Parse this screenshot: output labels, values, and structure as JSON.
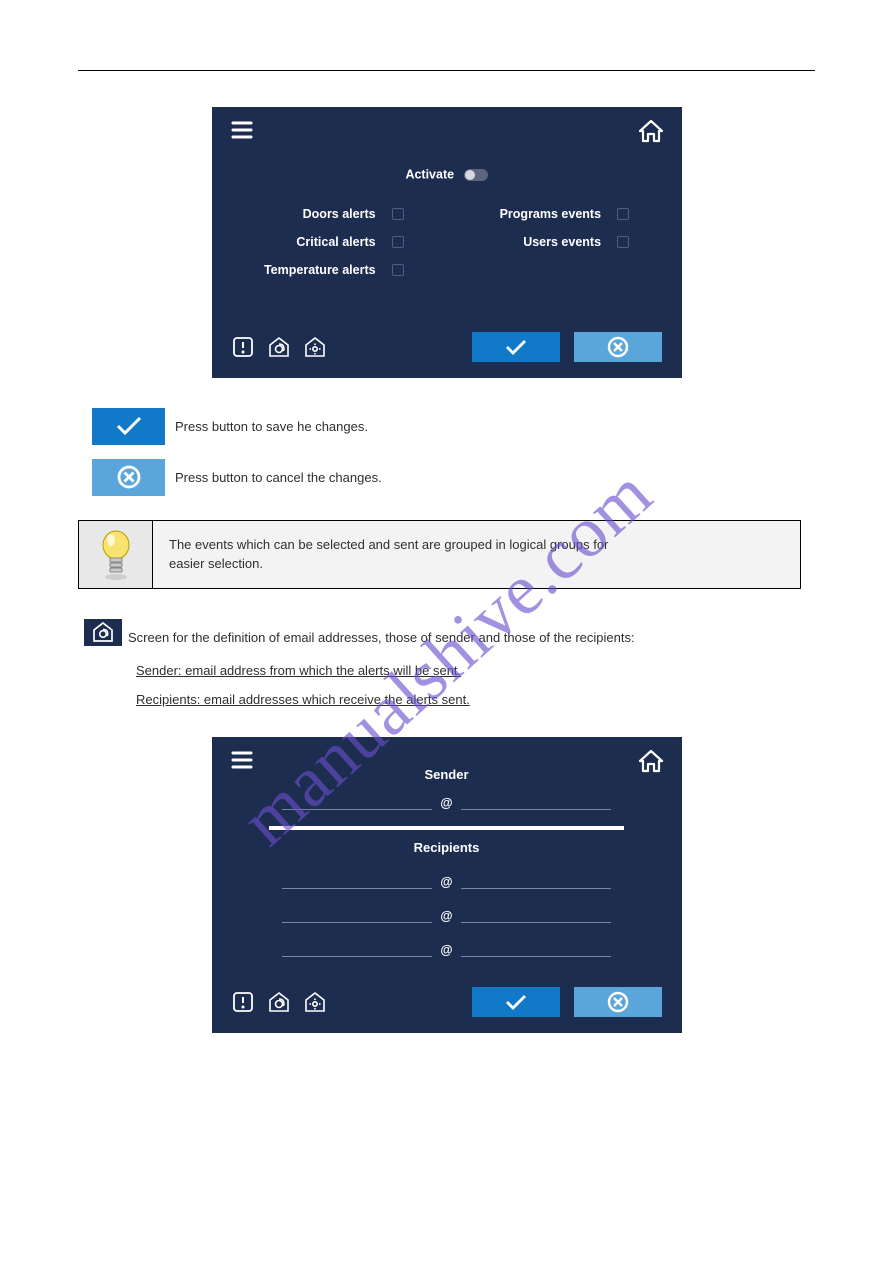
{
  "watermark": "manualshive.com",
  "panel1": {
    "activate_label": "Activate",
    "left_items": [
      "Doors alerts",
      "Critical alerts",
      "Temperature alerts"
    ],
    "right_items": [
      "Programs events",
      "Users events"
    ]
  },
  "buttons": {
    "ok_desc": "Press button to save he changes.",
    "cancel_desc": "Press button to cancel the changes."
  },
  "callout": {
    "line1": "The events which can be selected and sent are grouped in logical groups for",
    "line2": "easier selection."
  },
  "section": {
    "intro": "Screen for the definition of email addresses, those of sender and those of the recipients:",
    "sender_label": "Sender: email address from which the alerts will be sent.",
    "recipients_label": "Recipients: email addresses which receive the alerts sent."
  },
  "panel2": {
    "sender_title": "Sender",
    "at": "@",
    "recipients_title": "Recipients"
  }
}
